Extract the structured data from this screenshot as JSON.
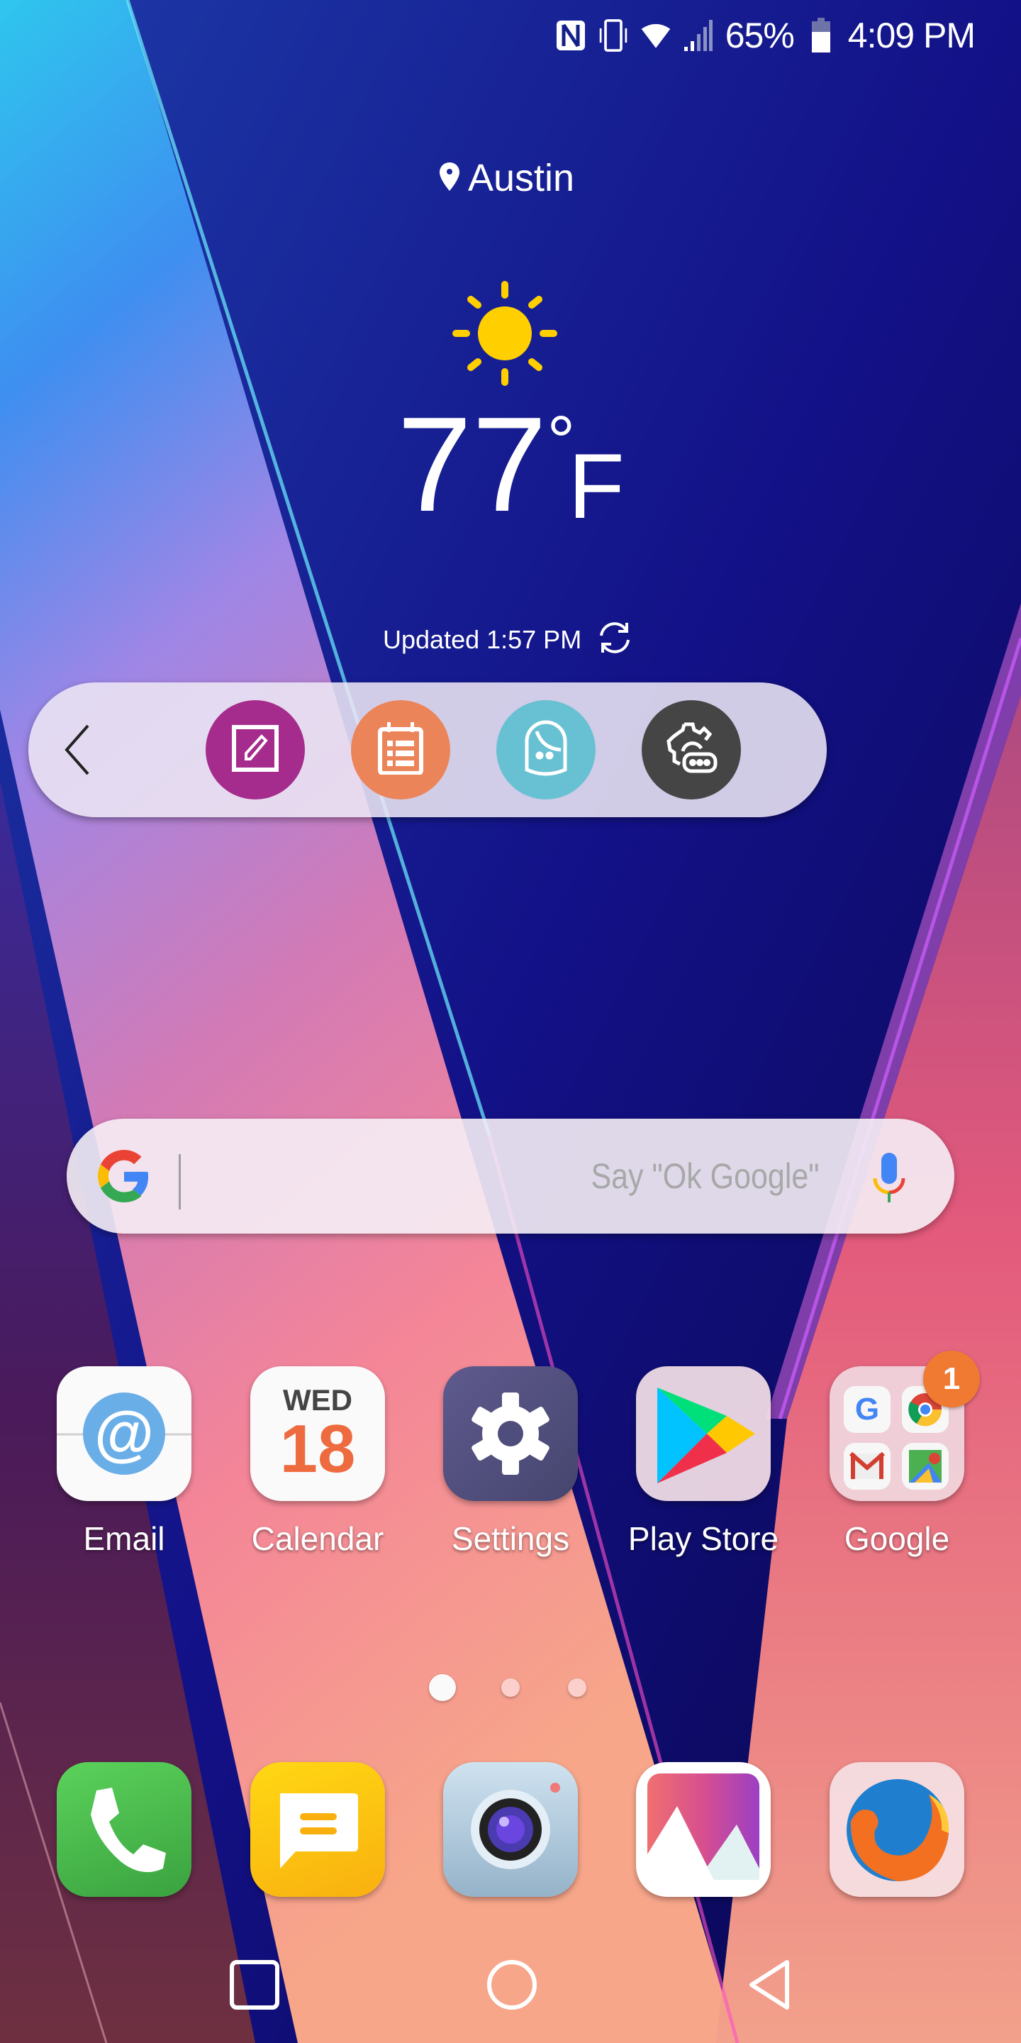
{
  "status_bar": {
    "icons": [
      "nfc-icon",
      "vibrate-icon",
      "wifi-icon",
      "cell-signal-icon",
      "battery-icon"
    ],
    "battery_percent": "65%",
    "battery_level": 0.65,
    "time": "4:09 PM"
  },
  "weather": {
    "location": "Austin",
    "condition_icon": "sun-icon",
    "temperature": "77",
    "degree_symbol": "°",
    "unit": "F",
    "updated": "Updated 1:57 PM"
  },
  "quick_tools": {
    "back_icon": "chevron-left-icon",
    "items": [
      {
        "name": "memo",
        "icon": "edit-note-icon",
        "color": "#a52c8c"
      },
      {
        "name": "tasks",
        "icon": "calendar-list-icon",
        "color": "#ec845a"
      },
      {
        "name": "face",
        "icon": "face-icon",
        "color": "#68c1d3"
      },
      {
        "name": "settings",
        "icon": "gear-keyboard-icon",
        "color": "#454545"
      }
    ]
  },
  "search": {
    "placeholder": "Say \"Ok Google\"",
    "logo_icon": "google-g-icon",
    "mic_icon": "mic-icon"
  },
  "apps": [
    {
      "label": "Email",
      "icon": "email-at-icon"
    },
    {
      "label": "Calendar",
      "icon": "calendar-icon",
      "day": "WED",
      "date": "18"
    },
    {
      "label": "Settings",
      "icon": "gear-icon"
    },
    {
      "label": "Play Store",
      "icon": "play-store-icon"
    },
    {
      "label": "Google",
      "icon": "google-folder-icon",
      "badge": "1"
    }
  ],
  "pager": {
    "pages": 3,
    "current": 1
  },
  "dock": [
    {
      "name": "phone",
      "icon": "phone-icon",
      "color": "#4caf50"
    },
    {
      "name": "messages",
      "icon": "message-icon",
      "color": "#fbc02d"
    },
    {
      "name": "camera",
      "icon": "camera-icon",
      "color": "#b8d4e8"
    },
    {
      "name": "gallery",
      "icon": "gallery-icon",
      "color": "#ffffff"
    },
    {
      "name": "firefox",
      "icon": "firefox-icon",
      "color": "#f07a32"
    }
  ],
  "navigation": {
    "buttons": [
      "recents-icon",
      "home-icon",
      "back-icon"
    ]
  }
}
